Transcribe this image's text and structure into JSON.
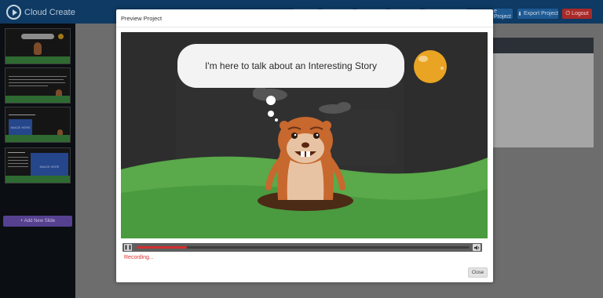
{
  "app": {
    "name": "Cloud Create"
  },
  "toolbar": {
    "preview_project_label": "e Project",
    "export_project_label": "Export Project",
    "logout_label": "Logout"
  },
  "sidebar": {
    "slides": [
      {
        "kind": "scene"
      },
      {
        "kind": "text-scene"
      },
      {
        "kind": "title-image",
        "image_label": "IMAGE HERE"
      },
      {
        "kind": "text-image",
        "image_label": "IMAGE HERE"
      }
    ],
    "add_slide_label": "+ Add New Slide"
  },
  "modal": {
    "title": "Preview Project",
    "speech_text": "I'm here to talk about an Interesting Story",
    "player": {
      "progress": 0.15
    },
    "status_text": "Recording...",
    "close_label": "Close"
  },
  "colors": {
    "topbar": "#0e3a63",
    "accent_red": "#d32f2f",
    "grass": "#5aa94a",
    "moon": "#e9a423"
  },
  "icons": [
    "play-circle-icon",
    "pause-icon",
    "volume-icon",
    "download-icon",
    "power-icon",
    "plus-icon"
  ]
}
